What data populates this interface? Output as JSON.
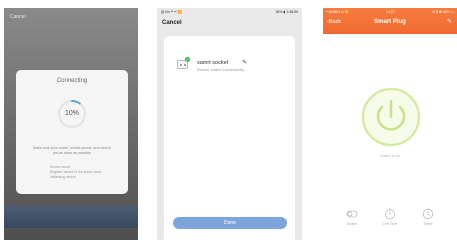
{
  "panel1": {
    "cancel": "Cancel",
    "title": "Connecting",
    "percent": "10%",
    "progress": 0.1,
    "instructions": "Make sure your router, mobile phone, and device are as close as possible",
    "steps": [
      "Device found",
      "Register device to the smart cloud",
      "Initializing device"
    ]
  },
  "panel2": {
    "status_left": "▥ No ᵃˡˡ ᵃˡˡ 🛜",
    "status_right": "38% ▮ 1:48:59",
    "cancel": "Cancel",
    "device_name": "samrt socket",
    "device_sub": "Device added successfully",
    "done": "Done"
  },
  "panel3": {
    "status_left": "ᵃˡˡ AHBIN ⊙ 🛜",
    "status_mid": "14:27",
    "status_right": "⊙ ⁑ ✱ 42% ▭",
    "back": "Back",
    "title": "Smart Plug",
    "switch_label": "Switch is on",
    "buttons": [
      {
        "label": "Switch",
        "icon": "switch-icon"
      },
      {
        "label": "Left Time",
        "icon": "timer-icon"
      },
      {
        "label": "Timer",
        "icon": "clock-icon"
      }
    ],
    "accent": "#f06a32",
    "power_color": "#c8e28a"
  }
}
